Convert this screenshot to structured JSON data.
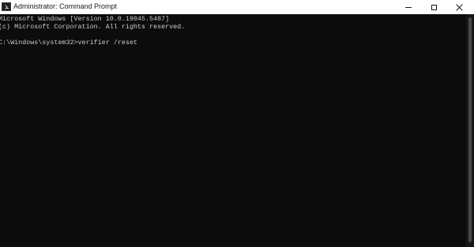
{
  "window": {
    "title": "Administrator: Command Prompt",
    "icon": "console-icon"
  },
  "controls": {
    "minimize_icon": "minimize-icon",
    "maximize_icon": "maximize-icon",
    "close_icon": "close-icon"
  },
  "console": {
    "lines": [
      "Microsoft Windows [Version 10.0.19045.5487]",
      "(c) Microsoft Corporation. All rights reserved.",
      "C:\\Windows\\system32>verifier /reset"
    ],
    "background_color": "#0c0c0c",
    "text_color": "#cccccc"
  }
}
